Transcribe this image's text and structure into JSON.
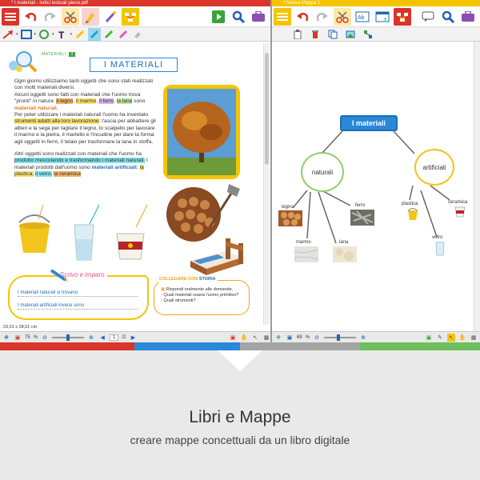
{
  "left_window": {
    "title": "* I materiali - indici testuali pieno.pdf",
    "statusbar": {
      "size": "23,01 x 28,51 cm",
      "zoom": "75",
      "zoom_unit": "%",
      "page": "1",
      "page_total": "/2"
    }
  },
  "right_window": {
    "title": "* Nuova Mappa 1",
    "statusbar": {
      "zoom": "69",
      "zoom_unit": "%"
    }
  },
  "book": {
    "section_tag": "MATERIALI",
    "section_num": "3",
    "heading": "I MATERIALI",
    "p1": "Ogni giorno utilizziamo tanti oggetti che sono stati realizzati con molti materiali diversi.",
    "p2a": "Alcuni oggetti sono fatti con materiali che l'uomo trova \"pronti\" in natura:",
    "w_legno": "il legno",
    "w_marmo": "il marmo",
    "w_ferro": "il ferro",
    "w_lana": "la lana",
    "p2b": "sono",
    "w_materiali_naturali": "materiali naturali.",
    "p3a": "Per poter utilizzare i materiali naturali l'uomo ha inventato",
    "w_strumenti": "strumenti adatti alla loro lavorazione",
    "p3b": ": l'ascia per abbattere gli alberi e la sega per tagliare il legno, lo scalpello per lavorare il marmo e la pietra, il martello e l'incudine per dare la forma agli oggetti in ferro, il telaio per trasformare la lana in stoffa.",
    "p4a": "Altri oggetti sono realizzati con materiali che l'uomo ha",
    "w_prodotto": "prodotto mescolando e trasformando i materiali naturali.",
    "p4b": "I materiali prodotti dall'uomo sono",
    "w_artificiali": "materiali artificiali:",
    "w_plastica": "la plastica,",
    "w_vetro": "il vetro,",
    "w_ceramica": "la ceramica",
    "scrivo_title": "Scrivo e imparo",
    "scrivo_l1": "I materiali naturali si trovano",
    "scrivo_l2": "I materiali artificiali invece sono",
    "storia_title_a": "COLLEGARE CON",
    "storia_title_b": "STORIA",
    "storia_l1": "Rispondi oralmente alle domande.",
    "storia_l2": "Quali materiali usava l'uomo primitivo?",
    "storia_l3": "Quali strumenti?"
  },
  "map": {
    "root": "I materiali",
    "n1": "naturali",
    "n2": "artificiali",
    "leaves": {
      "legno": "legno",
      "ferro": "ferro",
      "marmo": "marmo",
      "lana": "lana",
      "plastica": "plastica",
      "ceramica": "ceramica",
      "vetro": "vetro"
    }
  },
  "caption": {
    "title": "Libri e Mappe",
    "subtitle": "creare mappe concettuali da un libro digitale"
  },
  "colors": {
    "red": "#d9352b",
    "yellow": "#f5c400",
    "map_blue": "#2a88d8",
    "node_green": "#8fcf6a",
    "node_yellow": "#f0c419"
  }
}
